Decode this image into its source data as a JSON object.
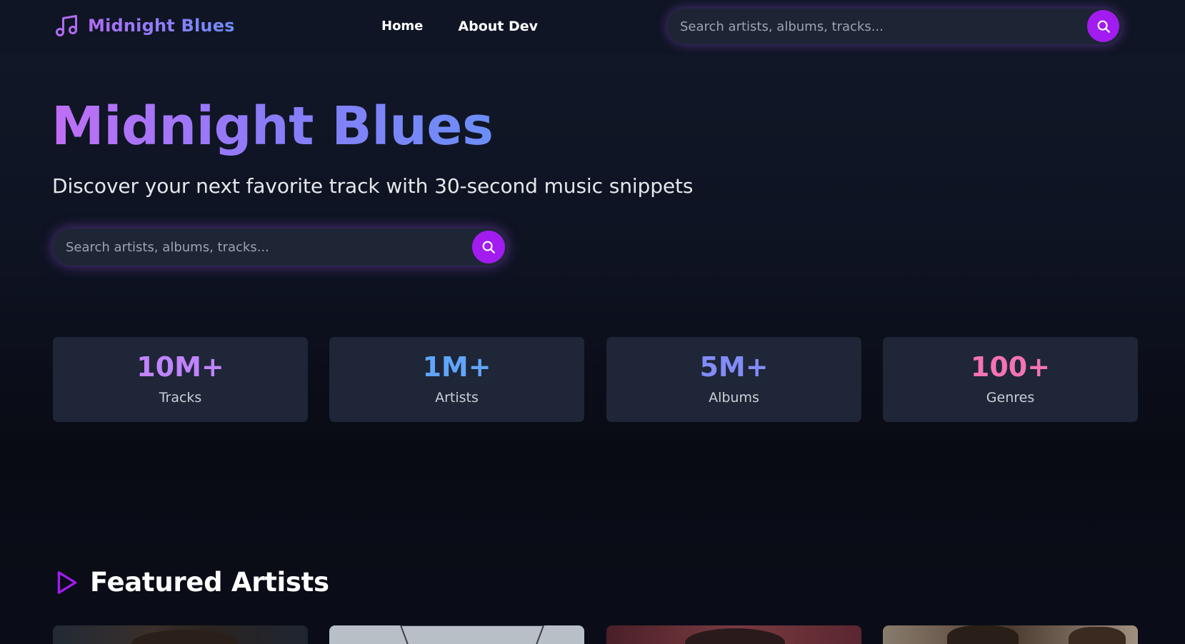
{
  "brand": {
    "name": "Midnight Blues",
    "icon": "music-note-icon"
  },
  "nav": {
    "links": [
      {
        "label": "Home"
      },
      {
        "label": "About Dev"
      }
    ]
  },
  "search": {
    "placeholder": "Search artists, albums, tracks...",
    "icon": "search-icon"
  },
  "hero": {
    "title": "Midnight Blues",
    "subtitle": "Discover your next favorite track with 30-second music snippets",
    "search_placeholder": "Search artists, albums, tracks..."
  },
  "stats": [
    {
      "value": "10M+",
      "label": "Tracks",
      "color": "#c084fc"
    },
    {
      "value": "1M+",
      "label": "Artists",
      "color": "#60a5fa"
    },
    {
      "value": "5M+",
      "label": "Albums",
      "color": "#818cf8"
    },
    {
      "value": "100+",
      "label": "Genres",
      "color": "#f472b6"
    }
  ],
  "featured": {
    "title": "Featured Artists",
    "icon": "play-icon"
  },
  "colors": {
    "accent": "#a21cf0",
    "background": "#0b0f1a",
    "card": "#1e2637"
  }
}
